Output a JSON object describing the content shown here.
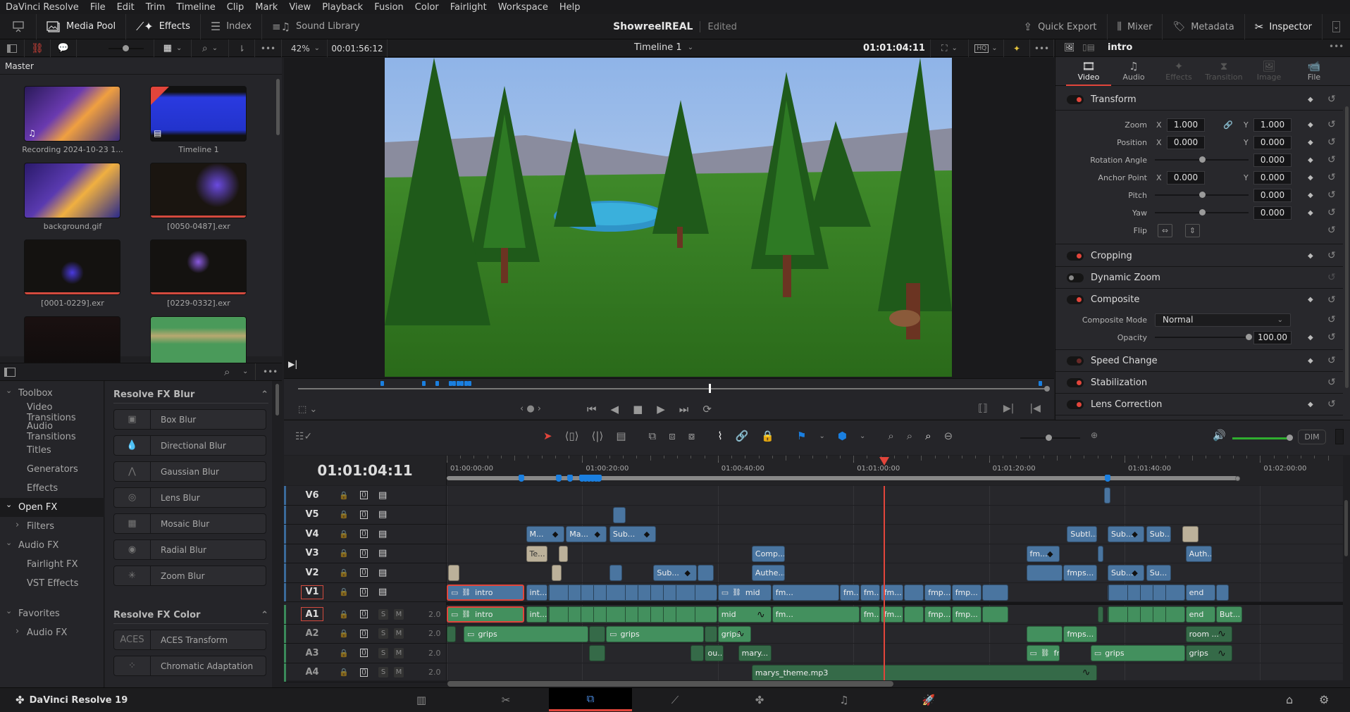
{
  "menu": [
    "DaVinci Resolve",
    "File",
    "Edit",
    "Trim",
    "Timeline",
    "Clip",
    "Mark",
    "View",
    "Playback",
    "Fusion",
    "Color",
    "Fairlight",
    "Workspace",
    "Help"
  ],
  "topbar": {
    "left": [
      {
        "label": "Media Pool",
        "icon": "media-pool-icon"
      },
      {
        "label": "Effects",
        "icon": "effects-wand-icon"
      },
      {
        "label": "Index",
        "icon": "index-list-icon"
      },
      {
        "label": "Sound Library",
        "icon": "sound-library-icon"
      }
    ],
    "project_name": "ShowreelREAL",
    "project_status": "Edited",
    "right": [
      {
        "label": "Quick Export",
        "icon": "export-icon"
      },
      {
        "label": "Mixer",
        "icon": "mixer-icon"
      },
      {
        "label": "Metadata",
        "icon": "metadata-tag-icon"
      },
      {
        "label": "Inspector",
        "icon": "inspector-tools-icon"
      }
    ]
  },
  "viewer": {
    "zoom": "42%",
    "duration": "00:01:56:12",
    "timeline_name": "Timeline 1",
    "timecode": "01:01:04:11",
    "playhead_fraction": 0.55
  },
  "media_pool": {
    "bin": "Master",
    "clips": [
      {
        "name": "Recording 2024-10-23 1...",
        "kind": "video-audio"
      },
      {
        "name": "Timeline 1",
        "kind": "timeline",
        "selected": true
      },
      {
        "name": "background.gif",
        "kind": "image"
      },
      {
        "name": "[0050-0487].exr",
        "kind": "image-sequence"
      },
      {
        "name": "[0001-0229].exr",
        "kind": "image-sequence"
      },
      {
        "name": "[0229-0332].exr",
        "kind": "image-sequence"
      },
      {
        "name": "",
        "kind": "video"
      },
      {
        "name": "",
        "kind": "audio"
      }
    ]
  },
  "effects": {
    "tree": [
      {
        "label": "Toolbox",
        "level": 0,
        "expanded": true
      },
      {
        "label": "Video Transitions",
        "level": 1
      },
      {
        "label": "Audio Transitions",
        "level": 1
      },
      {
        "label": "Titles",
        "level": 1
      },
      {
        "label": "Generators",
        "level": 1
      },
      {
        "label": "Effects",
        "level": 1
      },
      {
        "label": "Open FX",
        "level": 0,
        "expanded": true,
        "selected": true
      },
      {
        "label": "Filters",
        "level": 1,
        "collapsed": true
      },
      {
        "label": "Audio FX",
        "level": 0,
        "expanded": true
      },
      {
        "label": "Fairlight FX",
        "level": 1
      },
      {
        "label": "VST Effects",
        "level": 1
      },
      {
        "label": "Favorites",
        "level": 0,
        "expanded": true
      },
      {
        "label": "Audio FX",
        "level": 1,
        "collapsed": true
      }
    ],
    "groups": [
      {
        "title": "Resolve FX Blur",
        "items": [
          "Box Blur",
          "Directional Blur",
          "Gaussian Blur",
          "Lens Blur",
          "Mosaic Blur",
          "Radial Blur",
          "Zoom Blur"
        ]
      },
      {
        "title": "Resolve FX Color",
        "items": [
          "ACES Transform",
          "Chromatic Adaptation"
        ]
      }
    ]
  },
  "inspector": {
    "clip_name": "intro",
    "tabs": [
      {
        "label": "Video",
        "active": true
      },
      {
        "label": "Audio"
      },
      {
        "label": "Effects",
        "disabled": true
      },
      {
        "label": "Transition",
        "disabled": true
      },
      {
        "label": "Image",
        "disabled": true
      },
      {
        "label": "File"
      }
    ],
    "transform": {
      "title": "Transform",
      "zoom": {
        "label": "Zoom",
        "x": "1.000",
        "y": "1.000"
      },
      "position": {
        "label": "Position",
        "x": "0.000",
        "y": "0.000"
      },
      "rotation": {
        "label": "Rotation Angle",
        "value": "0.000"
      },
      "anchor": {
        "label": "Anchor Point",
        "x": "0.000",
        "y": "0.000"
      },
      "pitch": {
        "label": "Pitch",
        "value": "0.000"
      },
      "yaw": {
        "label": "Yaw",
        "value": "0.000"
      },
      "flip": {
        "label": "Flip"
      },
      "axis_x": "X",
      "axis_y": "Y"
    },
    "sections": [
      {
        "title": "Cropping",
        "state": "on"
      },
      {
        "title": "Dynamic Zoom",
        "state": "off"
      },
      {
        "title": "Composite",
        "state": "on"
      }
    ],
    "composite": {
      "mode_label": "Composite Mode",
      "mode": "Normal",
      "opacity_label": "Opacity",
      "opacity": "100.00"
    },
    "sections2": [
      {
        "title": "Speed Change",
        "state": "dim"
      },
      {
        "title": "Stabilization",
        "state": "on"
      },
      {
        "title": "Lens Correction",
        "state": "on"
      }
    ]
  },
  "timeline": {
    "timecode": "01:01:04:11",
    "ruler": [
      "01:00:00:00",
      "01:00:20:00",
      "01:00:40:00",
      "01:01:00:00",
      "01:01:20:00",
      "01:01:40:00",
      "01:02:00:00"
    ],
    "playhead_seconds": 64.4,
    "dim_label": "DIM",
    "tracks": [
      {
        "name": "V6",
        "type": "video"
      },
      {
        "name": "V5",
        "type": "video"
      },
      {
        "name": "V4",
        "type": "video"
      },
      {
        "name": "V3",
        "type": "video"
      },
      {
        "name": "V2",
        "type": "video"
      },
      {
        "name": "V1",
        "type": "video",
        "selected": true
      },
      {
        "name": "A1",
        "type": "audio",
        "selected": true,
        "channels": "2.0"
      },
      {
        "name": "A2",
        "type": "audio",
        "channels": "2.0"
      },
      {
        "name": "A3",
        "type": "audio",
        "channels": "2.0"
      },
      {
        "name": "A4",
        "type": "audio",
        "channels": "2.0"
      }
    ],
    "solo": "S",
    "mute": "M",
    "clips": [
      {
        "track": "V5",
        "start": 24.5,
        "end": 26.5,
        "label": "",
        "style": "v"
      },
      {
        "track": "V6",
        "start": 97,
        "end": 98,
        "label": "",
        "style": "v"
      },
      {
        "track": "V4",
        "start": 11.7,
        "end": 17.5,
        "label": "M...",
        "style": "v",
        "kf": true
      },
      {
        "track": "V4",
        "start": 17.6,
        "end": 23.7,
        "label": "Ma...",
        "style": "v",
        "kf": true
      },
      {
        "track": "V4",
        "start": 24,
        "end": 31,
        "label": "Sub...",
        "style": "v",
        "kf": true
      },
      {
        "track": "V4",
        "start": 91.5,
        "end": 96,
        "label": "Subtl...",
        "style": "v"
      },
      {
        "track": "V4",
        "start": 97.5,
        "end": 103,
        "label": "Sub...",
        "style": "v",
        "kf": true
      },
      {
        "track": "V4",
        "start": 103.2,
        "end": 107,
        "label": "Sub...",
        "style": "v"
      },
      {
        "track": "V4",
        "start": 108.5,
        "end": 111,
        "label": "",
        "style": "t"
      },
      {
        "track": "V3",
        "start": 11.7,
        "end": 15,
        "label": "Te...",
        "style": "t"
      },
      {
        "track": "V3",
        "start": 16.5,
        "end": 18,
        "label": "",
        "style": "t"
      },
      {
        "track": "V3",
        "start": 45,
        "end": 50,
        "label": "Comp...",
        "style": "v"
      },
      {
        "track": "V3",
        "start": 85.5,
        "end": 90.5,
        "label": "fm...",
        "style": "v",
        "kf": true
      },
      {
        "track": "V3",
        "start": 96,
        "end": 97,
        "label": "",
        "style": "v"
      },
      {
        "track": "V3",
        "start": 109,
        "end": 113,
        "label": "Auth...",
        "style": "v"
      },
      {
        "track": "V2",
        "start": 0.2,
        "end": 2,
        "label": "",
        "style": "t"
      },
      {
        "track": "V2",
        "start": 15.5,
        "end": 17,
        "label": "",
        "style": "t"
      },
      {
        "track": "V2",
        "start": 24,
        "end": 26,
        "label": "",
        "style": "v"
      },
      {
        "track": "V2",
        "start": 30.5,
        "end": 37,
        "label": "Sub...",
        "style": "v",
        "kf": true
      },
      {
        "track": "V2",
        "start": 37,
        "end": 39.5,
        "label": "",
        "style": "v"
      },
      {
        "track": "V2",
        "start": 45,
        "end": 50,
        "label": "Authe...",
        "style": "v"
      },
      {
        "track": "V2",
        "start": 85.5,
        "end": 91,
        "label": "",
        "style": "v"
      },
      {
        "track": "V2",
        "start": 91,
        "end": 96,
        "label": "fmps...",
        "style": "v"
      },
      {
        "track": "V2",
        "start": 97.5,
        "end": 103,
        "label": "Sub...",
        "style": "v",
        "kf": true
      },
      {
        "track": "V2",
        "start": 103.2,
        "end": 107,
        "label": "Su...",
        "style": "v"
      },
      {
        "track": "V1",
        "start": 0,
        "end": 11.5,
        "label": "intro",
        "style": "v",
        "selected": true,
        "icons": true
      },
      {
        "track": "V1",
        "start": 11.7,
        "end": 15,
        "label": "int...",
        "style": "v"
      },
      {
        "track": "V1",
        "start": 15,
        "end": 40,
        "label": "",
        "style": "v",
        "segments": true
      },
      {
        "track": "V1",
        "start": 40,
        "end": 48,
        "label": "mid",
        "style": "v",
        "icons": true
      },
      {
        "track": "V1",
        "start": 48,
        "end": 58,
        "label": "fm...",
        "style": "v"
      },
      {
        "track": "V1",
        "start": 58,
        "end": 61,
        "label": "fm...",
        "style": "v"
      },
      {
        "track": "V1",
        "start": 61,
        "end": 64,
        "label": "fm...",
        "style": "v"
      },
      {
        "track": "V1",
        "start": 64,
        "end": 67.5,
        "label": "fm...",
        "style": "v"
      },
      {
        "track": "V1",
        "start": 67.5,
        "end": 70.5,
        "label": "",
        "style": "v"
      },
      {
        "track": "V1",
        "start": 70.5,
        "end": 74.5,
        "label": "fmp...",
        "style": "v"
      },
      {
        "track": "V1",
        "start": 74.5,
        "end": 79,
        "label": "fmp...",
        "style": "v"
      },
      {
        "track": "V1",
        "start": 79,
        "end": 83,
        "label": "",
        "style": "v"
      },
      {
        "track": "V1",
        "start": 97.5,
        "end": 109,
        "label": "",
        "style": "v",
        "segments": true
      },
      {
        "track": "V1",
        "start": 109,
        "end": 113.5,
        "label": "end",
        "style": "v"
      },
      {
        "track": "V1",
        "start": 113.5,
        "end": 115.5,
        "label": "",
        "style": "v"
      },
      {
        "track": "A1",
        "start": 0,
        "end": 11.5,
        "label": "intro",
        "style": "a",
        "selected": true,
        "icons": true
      },
      {
        "track": "A1",
        "start": 11.7,
        "end": 15,
        "label": "int...",
        "style": "a"
      },
      {
        "track": "A1",
        "start": 15,
        "end": 40,
        "label": "",
        "style": "a",
        "segments": true
      },
      {
        "track": "A1",
        "start": 40,
        "end": 48,
        "label": "mid",
        "style": "a",
        "wave": true
      },
      {
        "track": "A1",
        "start": 48,
        "end": 61,
        "label": "fm...",
        "style": "a"
      },
      {
        "track": "A1",
        "start": 61,
        "end": 64,
        "label": "fm...",
        "style": "a"
      },
      {
        "track": "A1",
        "start": 64,
        "end": 67.5,
        "label": "fm...",
        "style": "a"
      },
      {
        "track": "A1",
        "start": 67.5,
        "end": 70.5,
        "label": "",
        "style": "a"
      },
      {
        "track": "A1",
        "start": 70.5,
        "end": 74.5,
        "label": "fmp...",
        "style": "a"
      },
      {
        "track": "A1",
        "start": 74.5,
        "end": 79,
        "label": "fmp...",
        "style": "a"
      },
      {
        "track": "A1",
        "start": 79,
        "end": 83,
        "label": "",
        "style": "a"
      },
      {
        "track": "A1",
        "start": 96,
        "end": 97,
        "label": "",
        "style": "ad"
      },
      {
        "track": "A1",
        "start": 97.5,
        "end": 109,
        "label": "",
        "style": "a",
        "segments": true
      },
      {
        "track": "A1",
        "start": 109,
        "end": 113.5,
        "label": "end",
        "style": "a"
      },
      {
        "track": "A1",
        "start": 113.5,
        "end": 117.5,
        "label": "But...",
        "style": "a"
      },
      {
        "track": "A2",
        "start": 0,
        "end": 1.5,
        "label": "",
        "style": "ad"
      },
      {
        "track": "A2",
        "start": 2.5,
        "end": 21,
        "label": "grips",
        "style": "a",
        "icons": true
      },
      {
        "track": "A2",
        "start": 21,
        "end": 23.5,
        "label": "",
        "style": "ad"
      },
      {
        "track": "A2",
        "start": 23.5,
        "end": 38,
        "label": "grips",
        "style": "a",
        "icons": true
      },
      {
        "track": "A2",
        "start": 38,
        "end": 40,
        "label": "",
        "style": "ad"
      },
      {
        "track": "A2",
        "start": 40,
        "end": 45,
        "label": "grips",
        "style": "a",
        "wave": true
      },
      {
        "track": "A2",
        "start": 85.5,
        "end": 91,
        "label": "",
        "style": "a"
      },
      {
        "track": "A2",
        "start": 91,
        "end": 96,
        "label": "fmps...",
        "style": "a"
      },
      {
        "track": "A2",
        "start": 109,
        "end": 116,
        "label": "room ...",
        "style": "ad",
        "wave": true
      },
      {
        "track": "A3",
        "start": 21,
        "end": 23.5,
        "label": "",
        "style": "ad"
      },
      {
        "track": "A3",
        "start": 36,
        "end": 38,
        "label": "",
        "style": "ad"
      },
      {
        "track": "A3",
        "start": 38,
        "end": 41,
        "label": "ou...",
        "style": "ad"
      },
      {
        "track": "A3",
        "start": 43,
        "end": 48,
        "label": "mary...",
        "style": "ad"
      },
      {
        "track": "A3",
        "start": 85.5,
        "end": 90.5,
        "label": "fm...",
        "style": "a",
        "icons": true
      },
      {
        "track": "A3",
        "start": 95,
        "end": 109,
        "label": "grips",
        "style": "a",
        "icons": true
      },
      {
        "track": "A3",
        "start": 109,
        "end": 116,
        "label": "grips",
        "style": "ad",
        "wave": true
      },
      {
        "track": "A4",
        "start": 45,
        "end": 96,
        "label": "marys_theme.mp3",
        "style": "ad",
        "wave": true
      }
    ],
    "markers_seconds": [
      11,
      16.5,
      18.2,
      20,
      20.5,
      21,
      21.5,
      22,
      22.5,
      97.5
    ]
  },
  "bottom": {
    "app": "DaVinci Resolve 19",
    "pages": [
      {
        "name": "media",
        "icon": "media-page-icon"
      },
      {
        "name": "cut",
        "icon": "cut-page-icon"
      },
      {
        "name": "edit",
        "icon": "edit-page-icon",
        "active": true
      },
      {
        "name": "fusion",
        "icon": "fusion-page-icon"
      },
      {
        "name": "color",
        "icon": "color-page-icon"
      },
      {
        "name": "fairlight",
        "icon": "fairlight-page-icon"
      },
      {
        "name": "deliver",
        "icon": "deliver-page-icon"
      }
    ]
  },
  "colors": {
    "accent": "#e2453b",
    "video_clip": "#4a75a0",
    "audio_clip": "#43905e",
    "marker": "#1a7fe0",
    "audio_level": "#2fae2f"
  }
}
